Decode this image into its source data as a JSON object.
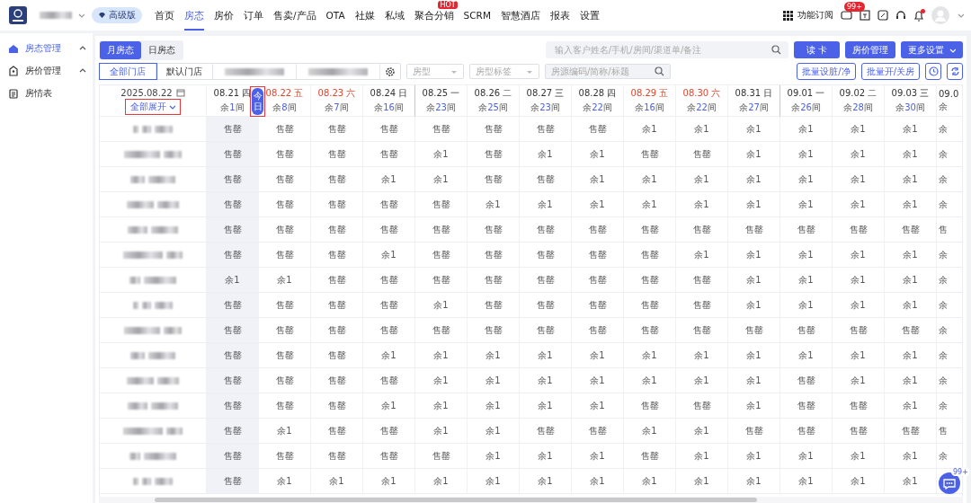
{
  "topbar": {
    "edition": "高级版",
    "nav": [
      {
        "label": "首页",
        "selected": false
      },
      {
        "label": "房态",
        "selected": true
      },
      {
        "label": "房价",
        "selected": false
      },
      {
        "label": "订单",
        "selected": false
      },
      {
        "label": "售卖/产品",
        "selected": false
      },
      {
        "label": "OTA",
        "selected": false
      },
      {
        "label": "社媒",
        "selected": false
      },
      {
        "label": "私域",
        "selected": false
      },
      {
        "label": "聚合分销",
        "selected": false,
        "badge": "HOT"
      },
      {
        "label": "SCRM",
        "selected": false
      },
      {
        "label": "智慧酒店",
        "selected": false
      },
      {
        "label": "报表",
        "selected": false
      },
      {
        "label": "设置",
        "selected": false
      }
    ],
    "subscribe": "功能订阅",
    "message_badge": "99+",
    "bell_dot": true
  },
  "sidebar": {
    "items": [
      {
        "label": "房态管理",
        "selected": true,
        "expanded": true
      },
      {
        "label": "房价管理",
        "selected": false,
        "expanded": true
      },
      {
        "label": "房情表",
        "selected": false
      }
    ]
  },
  "view_tabs": [
    {
      "label": "月房态",
      "selected": true
    },
    {
      "label": "日房态",
      "selected": false
    }
  ],
  "search": {
    "placeholder": "输入客户姓名/手机/房间/渠道单/备注"
  },
  "buttons": [
    {
      "label": "读 卡",
      "kind": "plain"
    },
    {
      "label": "房价管理",
      "kind": "plain"
    },
    {
      "label": "更多设置",
      "kind": "dropdown"
    }
  ],
  "store_tabs": [
    {
      "label": "全部门店",
      "selected": true
    },
    {
      "label": "默认门店",
      "selected": false
    },
    {
      "redacted": true,
      "selected": false
    },
    {
      "redacted": true,
      "selected": false
    }
  ],
  "filters": [
    {
      "placeholder": "房型",
      "kind": "select"
    },
    {
      "placeholder": "房型标签",
      "kind": "select"
    },
    {
      "placeholder": "房源编码/简称/标题",
      "kind": "search"
    }
  ],
  "actions": [
    {
      "label": "批量设脏/净",
      "kind": "text"
    },
    {
      "label": "批量开/关房",
      "kind": "text"
    },
    {
      "kind": "clock"
    },
    {
      "kind": "refresh"
    }
  ],
  "grid": {
    "date": "2025.08.22",
    "expand_link": "全部展开",
    "expand_marked": true,
    "today_badge": "今日",
    "today_marked": true,
    "columns": [
      {
        "date": "08.21",
        "weekday": "四",
        "weekend": false,
        "highlighted": true,
        "left": {
          "pre": "余",
          "count": "1",
          "post": "间"
        }
      },
      {
        "date": "08.22",
        "weekday": "五",
        "weekend": true,
        "today": true,
        "left": {
          "pre": "余",
          "count": "8",
          "post": "间"
        }
      },
      {
        "date": "08.23",
        "weekday": "六",
        "weekend": true,
        "left": {
          "pre": "余",
          "count": "7",
          "post": "间"
        }
      },
      {
        "date": "08.24",
        "weekday": "日",
        "weekend": false,
        "left": {
          "pre": "余",
          "count": "16",
          "post": "间"
        }
      },
      {
        "date": "08.25",
        "weekday": "一",
        "weekend": false,
        "week_start": true,
        "left": {
          "pre": "余",
          "count": "23",
          "post": "间"
        }
      },
      {
        "date": "08.26",
        "weekday": "二",
        "weekend": false,
        "left": {
          "pre": "余",
          "count": "25",
          "post": "间"
        }
      },
      {
        "date": "08.27",
        "weekday": "三",
        "weekend": false,
        "left": {
          "pre": "余",
          "count": "23",
          "post": "间"
        }
      },
      {
        "date": "08.28",
        "weekday": "四",
        "weekend": false,
        "left": {
          "pre": "余",
          "count": "22",
          "post": "间"
        }
      },
      {
        "date": "08.29",
        "weekday": "五",
        "weekend": true,
        "left": {
          "pre": "余",
          "count": "16",
          "post": "间"
        }
      },
      {
        "date": "08.30",
        "weekday": "六",
        "weekend": true,
        "left": {
          "pre": "余",
          "count": "22",
          "post": "间"
        }
      },
      {
        "date": "08.31",
        "weekday": "日",
        "weekend": false,
        "left": {
          "pre": "余",
          "count": "27",
          "post": "间"
        }
      },
      {
        "date": "09.01",
        "weekday": "一",
        "weekend": false,
        "week_start": true,
        "left": {
          "pre": "余",
          "count": "26",
          "post": "间"
        }
      },
      {
        "date": "09.02",
        "weekday": "二",
        "weekend": false,
        "left": {
          "pre": "余",
          "count": "28",
          "post": "间"
        }
      },
      {
        "date": "09.03",
        "weekday": "三",
        "weekend": false,
        "left": {
          "pre": "余",
          "count": "30",
          "post": "间"
        }
      },
      {
        "date": "09.0",
        "weekend": false,
        "cut": true,
        "left": {
          "pre": "余"
        }
      }
    ],
    "rows": [
      {
        "cells": [
          "售罄",
          "售罄",
          "售罄",
          "售罄",
          "售罄",
          "售罄",
          "售罄",
          "售罄",
          "余1",
          "余1",
          "余1",
          "余1",
          "余1",
          "余1",
          "余"
        ]
      },
      {
        "cells": [
          "售罄",
          "售罄",
          "售罄",
          "售罄",
          "余1",
          "售罄",
          "余1",
          "余1",
          "售罄",
          "售罄",
          "余1",
          "余1",
          "余1",
          "余1",
          "余"
        ]
      },
      {
        "cells": [
          "售罄",
          "售罄",
          "售罄",
          "余1",
          "余1",
          "售罄",
          "售罄",
          "余1",
          "余1",
          "余1",
          "余1",
          "余1",
          "余1",
          "余1",
          "余"
        ]
      },
      {
        "cells": [
          "售罄",
          "售罄",
          "售罄",
          "售罄",
          "售罄",
          "余1",
          "余1",
          "余1",
          "余1",
          "余1",
          "余1",
          "余1",
          "余1",
          "余1",
          "余"
        ]
      },
      {
        "cells": [
          "售罄",
          "售罄",
          "售罄",
          "售罄",
          "售罄",
          "售罄",
          "售罄",
          "售罄",
          "售罄",
          "售罄",
          "售罄",
          "售罄",
          "售罄",
          "售罄",
          "售"
        ]
      },
      {
        "cells": [
          "售罄",
          "售罄",
          "售罄",
          "余1",
          "售罄",
          "售罄",
          "售罄",
          "售罄",
          "售罄",
          "余1",
          "余1",
          "余1",
          "余1",
          "余1",
          "余"
        ]
      },
      {
        "cells": [
          "余1",
          "余1",
          "售罄",
          "售罄",
          "售罄",
          "售罄",
          "售罄",
          "售罄",
          "售罄",
          "售罄",
          "余1",
          "余1",
          "余1",
          "余1",
          "余"
        ]
      },
      {
        "cells": [
          "售罄",
          "售罄",
          "售罄",
          "售罄",
          "余1",
          "售罄",
          "售罄",
          "售罄",
          "售罄",
          "售罄",
          "余1",
          "余1",
          "余1",
          "余1",
          "余"
        ]
      },
      {
        "cells": [
          "售罄",
          "售罄",
          "售罄",
          "售罄",
          "售罄",
          "售罄",
          "售罄",
          "售罄",
          "售罄",
          "售罄",
          "售罄",
          "售罄",
          "售罄",
          "售罄",
          "余"
        ]
      },
      {
        "cells": [
          "售罄",
          "售罄",
          "售罄",
          "余1",
          "余1",
          "余1",
          "余1",
          "余1",
          "余1",
          "余1",
          "余1",
          "余1",
          "余1",
          "余1",
          "余"
        ]
      },
      {
        "cells": [
          "售罄",
          "售罄",
          "售罄",
          "售罄",
          "余1",
          "余1",
          "余1",
          "余1",
          "余1",
          "余1",
          "余1",
          "售罄",
          "余1",
          "余1",
          "余"
        ]
      },
      {
        "cells": [
          "售罄",
          "售罄",
          "售罄",
          "余1",
          "余1",
          "余1",
          "余1",
          "余1",
          "售罄",
          "售罄",
          "余1",
          "售罄",
          "售罄",
          "余1",
          "余"
        ]
      },
      {
        "cells": [
          "售罄",
          "余1",
          "售罄",
          "售罄",
          "余1",
          "余1",
          "售罄",
          "售罄",
          "余1",
          "余1",
          "售罄",
          "售罄",
          "售罄",
          "售罄",
          "售"
        ]
      },
      {
        "cells": [
          "售罄",
          "售罄",
          "售罄",
          "售罄",
          "售罄",
          "余1",
          "余1",
          "余1",
          "售罄",
          "余1",
          "余1",
          "余1",
          "余1",
          "余1",
          "余"
        ]
      },
      {
        "cells": [
          "售罄",
          "余1",
          "余1",
          "余1",
          "余1",
          "余1",
          "余1",
          "余1",
          "余1",
          "余1",
          "余1",
          "余1",
          "余1",
          "余1"
        ]
      }
    ]
  },
  "chat_badge": "99+"
}
